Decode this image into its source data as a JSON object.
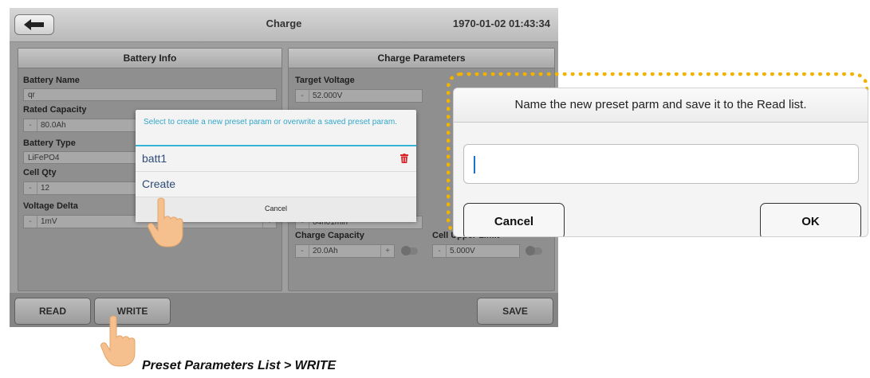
{
  "screen": {
    "title": "Charge",
    "datetime": "1970-01-02 01:43:34",
    "back_icon": "back-arrow-icon"
  },
  "battery_info": {
    "heading": "Battery Info",
    "name_label": "Battery Name",
    "name_value": "qr",
    "rated_capacity_label": "Rated Capacity",
    "rated_capacity_value": "80.0Ah",
    "type_label": "Battery Type",
    "type_value": "LiFePO4",
    "cell_qty_label": "Cell Qty",
    "cell_qty_value": "12",
    "voltage_delta_label": "Voltage Delta",
    "voltage_delta_value": "1mV"
  },
  "charge_params": {
    "heading": "Charge Parameters",
    "target_voltage_label": "Target Voltage",
    "target_voltage_value": "52.000V",
    "time_value": "04h01min",
    "charge_capacity_label": "Charge Capacity",
    "charge_capacity_value": "20.0Ah",
    "cell_upper_limit_label": "Cell Upper Limit",
    "cell_upper_limit_value": "5.000V"
  },
  "bottom_bar": {
    "read": "READ",
    "write": "WRITE",
    "save": "SAVE"
  },
  "preset_dialog": {
    "message": "Select to create a new preset param or overwrite a saved preset param.",
    "items": [
      {
        "label": "batt1",
        "icon": "trash-icon"
      },
      {
        "label": "Create"
      }
    ],
    "cancel": "Cancel"
  },
  "name_dialog": {
    "title": "Name the new preset parm and save it to the Read list.",
    "input_value": "",
    "cancel": "Cancel",
    "ok": "OK"
  },
  "caption": "Preset Parameters List > WRITE",
  "colors": {
    "callout_border": "#f2b200",
    "dialog_accent": "#36b4d6",
    "trash": "#d9262b",
    "hand": "#f5c08e"
  }
}
